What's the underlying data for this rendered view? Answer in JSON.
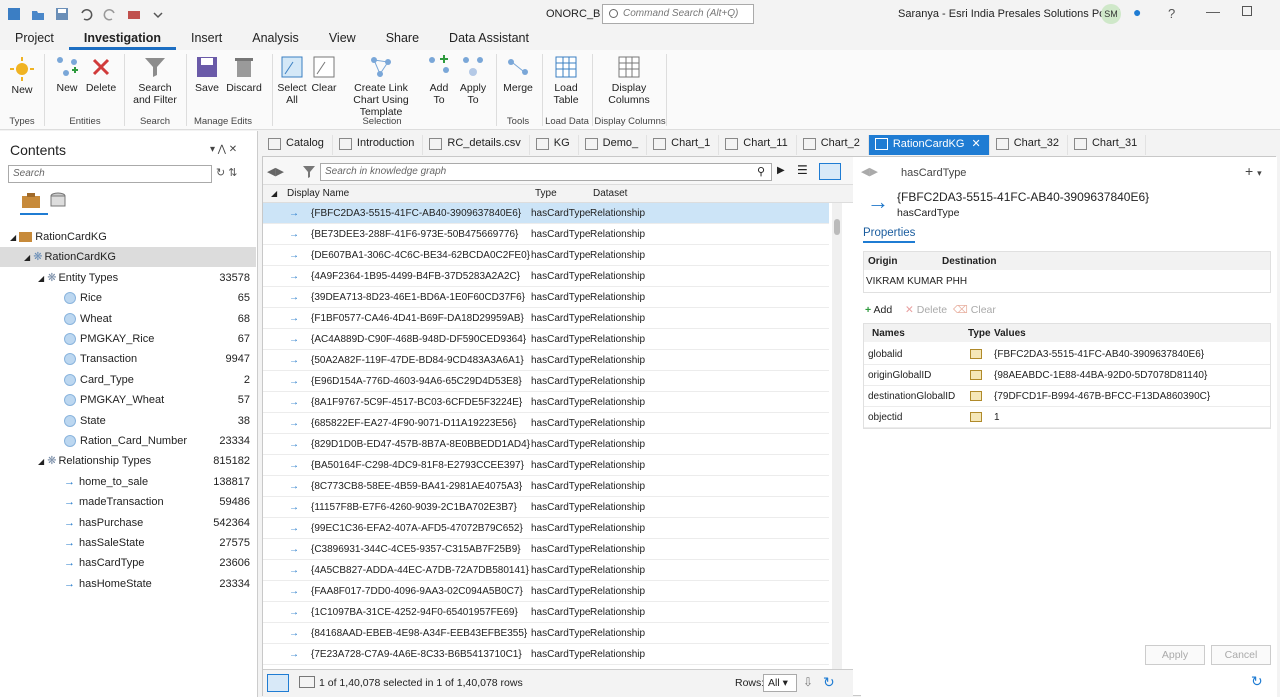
{
  "titlebar": {
    "project_name": "ONORC_B",
    "command_search_placeholder": "Command Search (Alt+Q)",
    "user": "Saranya - Esri India Presales Solutions Portal",
    "avatar": "SM"
  },
  "menu": [
    "Project",
    "Investigation",
    "Insert",
    "Analysis",
    "View",
    "Share",
    "Data Assistant"
  ],
  "ribbon": {
    "buttons": [
      {
        "label": "New",
        "name": "new-button"
      },
      {
        "label": "New",
        "name": "new-entity-button"
      },
      {
        "label": "Delete",
        "name": "delete-button"
      },
      {
        "label": "Search and Filter",
        "name": "search-filter-button"
      },
      {
        "label": "Save",
        "name": "save-button"
      },
      {
        "label": "Discard",
        "name": "discard-button"
      },
      {
        "label": "Select All",
        "name": "select-all-button"
      },
      {
        "label": "Clear",
        "name": "clear-button"
      },
      {
        "label": "Create Link Chart Using Template",
        "name": "create-link-chart-button"
      },
      {
        "label": "Add To",
        "name": "add-to-button"
      },
      {
        "label": "Apply To",
        "name": "apply-to-button"
      },
      {
        "label": "Merge",
        "name": "merge-button"
      },
      {
        "label": "Load Table",
        "name": "load-table-button"
      },
      {
        "label": "Display Columns",
        "name": "display-columns-button"
      }
    ],
    "groups": [
      "Types",
      "Entities",
      "Search",
      "Manage Edits",
      "Selection",
      "Tools",
      "Load Data",
      "Display Columns"
    ]
  },
  "contents": {
    "title": "Contents",
    "search_placeholder": "Search",
    "tree": [
      {
        "label": "RationCardKG",
        "count": "",
        "level": 0,
        "kind": "root"
      },
      {
        "label": "RationCardKG",
        "count": "",
        "level": 1,
        "kind": "kg"
      },
      {
        "label": "Entity Types",
        "count": "33578",
        "level": 2,
        "kind": "group"
      },
      {
        "label": "Rice",
        "count": "65",
        "level": 3,
        "kind": "entity"
      },
      {
        "label": "Wheat",
        "count": "68",
        "level": 3,
        "kind": "entity"
      },
      {
        "label": "PMGKAY_Rice",
        "count": "67",
        "level": 3,
        "kind": "entity"
      },
      {
        "label": "Transaction",
        "count": "9947",
        "level": 3,
        "kind": "entity"
      },
      {
        "label": "Card_Type",
        "count": "2",
        "level": 3,
        "kind": "entity"
      },
      {
        "label": "PMGKAY_Wheat",
        "count": "57",
        "level": 3,
        "kind": "entity"
      },
      {
        "label": "State",
        "count": "38",
        "level": 3,
        "kind": "entity"
      },
      {
        "label": "Ration_Card_Number",
        "count": "23334",
        "level": 3,
        "kind": "entity"
      },
      {
        "label": "Relationship Types",
        "count": "815182",
        "level": 2,
        "kind": "group"
      },
      {
        "label": "home_to_sale",
        "count": "138817",
        "level": 3,
        "kind": "rel"
      },
      {
        "label": "madeTransaction",
        "count": "59486",
        "level": 3,
        "kind": "rel"
      },
      {
        "label": "hasPurchase",
        "count": "542364",
        "level": 3,
        "kind": "rel"
      },
      {
        "label": "hasSaleState",
        "count": "27575",
        "level": 3,
        "kind": "rel"
      },
      {
        "label": "hasCardType",
        "count": "23606",
        "level": 3,
        "kind": "rel"
      },
      {
        "label": "hasHomeState",
        "count": "23334",
        "level": 3,
        "kind": "rel"
      }
    ]
  },
  "tabs": [
    {
      "label": "Catalog",
      "active": false
    },
    {
      "label": "Introduction",
      "active": false
    },
    {
      "label": "RC_details.csv",
      "active": false
    },
    {
      "label": "KG",
      "active": false
    },
    {
      "label": "Demo_",
      "active": false
    },
    {
      "label": "Chart_1",
      "active": false
    },
    {
      "label": "Chart_11",
      "active": false
    },
    {
      "label": "Chart_2",
      "active": false
    },
    {
      "label": "RationCardKG",
      "active": true
    },
    {
      "label": "Chart_32",
      "active": false
    },
    {
      "label": "Chart_31",
      "active": false
    }
  ],
  "list": {
    "search_placeholder": "Search in knowledge graph",
    "columns": [
      "Display Name",
      "Type",
      "Dataset"
    ],
    "rows": [
      {
        "name": "{FBFC2DA3-5515-41FC-AB40-3909637840E6}",
        "type": "hasCardType",
        "dataset": "Relationship",
        "selected": true
      },
      {
        "name": "{BE73DEE3-288F-41F6-973E-50B475669776}",
        "type": "hasCardType",
        "dataset": "Relationship"
      },
      {
        "name": "{DE607BA1-306C-4C6C-BE34-62BCDA0C2FE0}",
        "type": "hasCardType",
        "dataset": "Relationship"
      },
      {
        "name": "{4A9F2364-1B95-4499-B4FB-37D5283A2A2C}",
        "type": "hasCardType",
        "dataset": "Relationship"
      },
      {
        "name": "{39DEA713-8D23-46E1-BD6A-1E0F60CD37F6}",
        "type": "hasCardType",
        "dataset": "Relationship"
      },
      {
        "name": "{F1BF0577-CA46-4D41-B69F-DA18D29959AB}",
        "type": "hasCardType",
        "dataset": "Relationship"
      },
      {
        "name": "{AC4A889D-C90F-468B-948D-DF590CED9364}",
        "type": "hasCardType",
        "dataset": "Relationship"
      },
      {
        "name": "{50A2A82F-119F-47DE-BD84-9CD483A3A6A1}",
        "type": "hasCardType",
        "dataset": "Relationship"
      },
      {
        "name": "{E96D154A-776D-4603-94A6-65C29D4D53E8}",
        "type": "hasCardType",
        "dataset": "Relationship"
      },
      {
        "name": "{8A1F9767-5C9F-4517-BC03-6CFDE5F3224E}",
        "type": "hasCardType",
        "dataset": "Relationship"
      },
      {
        "name": "{685822EF-EA27-4F90-9071-D11A19223E56}",
        "type": "hasCardType",
        "dataset": "Relationship"
      },
      {
        "name": "{829D1D0B-ED47-457B-8B7A-8E0BBEDD1AD4}",
        "type": "hasCardType",
        "dataset": "Relationship"
      },
      {
        "name": "{BA50164F-C298-4DC9-81F8-E2793CCEE397}",
        "type": "hasCardType",
        "dataset": "Relationship"
      },
      {
        "name": "{8C773CB8-58EE-4B59-BA41-2981AE4075A3}",
        "type": "hasCardType",
        "dataset": "Relationship"
      },
      {
        "name": "{11157F8B-E7F6-4260-9039-2C1BA702E3B7}",
        "type": "hasCardType",
        "dataset": "Relationship"
      },
      {
        "name": "{99EC1C36-EFA2-407A-AFD5-47072B79C652}",
        "type": "hasCardType",
        "dataset": "Relationship"
      },
      {
        "name": "{C3896931-344C-4CE5-9357-C315AB7F25B9}",
        "type": "hasCardType",
        "dataset": "Relationship"
      },
      {
        "name": "{4A5CB827-ADDA-44EC-A7DB-72A7DB580141}",
        "type": "hasCardType",
        "dataset": "Relationship"
      },
      {
        "name": "{FAA8F017-7DD0-4096-9AA3-02C094A5B0C7}",
        "type": "hasCardType",
        "dataset": "Relationship"
      },
      {
        "name": "{1C1097BA-31CE-4252-94F0-65401957FE69}",
        "type": "hasCardType",
        "dataset": "Relationship"
      },
      {
        "name": "{84168AAD-EBEB-4E98-A34F-EEB43EFBE355}",
        "type": "hasCardType",
        "dataset": "Relationship"
      },
      {
        "name": "{7E23A728-C7A9-4A6E-8C33-B6B5413710C1}",
        "type": "hasCardType",
        "dataset": "Relationship"
      }
    ],
    "status": "1 of 1,40,078 selected in 1 of 1,40,078 rows",
    "rows_label": "Rows:",
    "rows_value": "All"
  },
  "detail": {
    "header_type": "hasCardType",
    "title": "{FBFC2DA3-5515-41FC-AB40-3909637840E6}",
    "subtitle": "hasCardType",
    "properties_tab": "Properties",
    "origin_label": "Origin",
    "destination_label": "Destination",
    "origin_value": "VIKRAM KUMAR PHH",
    "add_label": "Add",
    "delete_label": "Delete",
    "clear_label": "Clear",
    "columns": [
      "Names",
      "Type",
      "Values"
    ],
    "props": [
      {
        "name": "globalid",
        "value": "{FBFC2DA3-5515-41FC-AB40-3909637840E6}"
      },
      {
        "name": "originGlobalID",
        "value": "{98AEABDC-1E88-44BA-92D0-5D7078D81140}"
      },
      {
        "name": "destinationGlobalID",
        "value": "{79DFCD1F-B994-467B-BFCC-F13DA860390C}"
      },
      {
        "name": "objectid",
        "value": "1"
      }
    ],
    "apply_label": "Apply",
    "cancel_label": "Cancel"
  },
  "colors": {
    "accent": "#1f7cd3",
    "selected_row": "#cce4f7",
    "arrow": "#1f77c9"
  }
}
